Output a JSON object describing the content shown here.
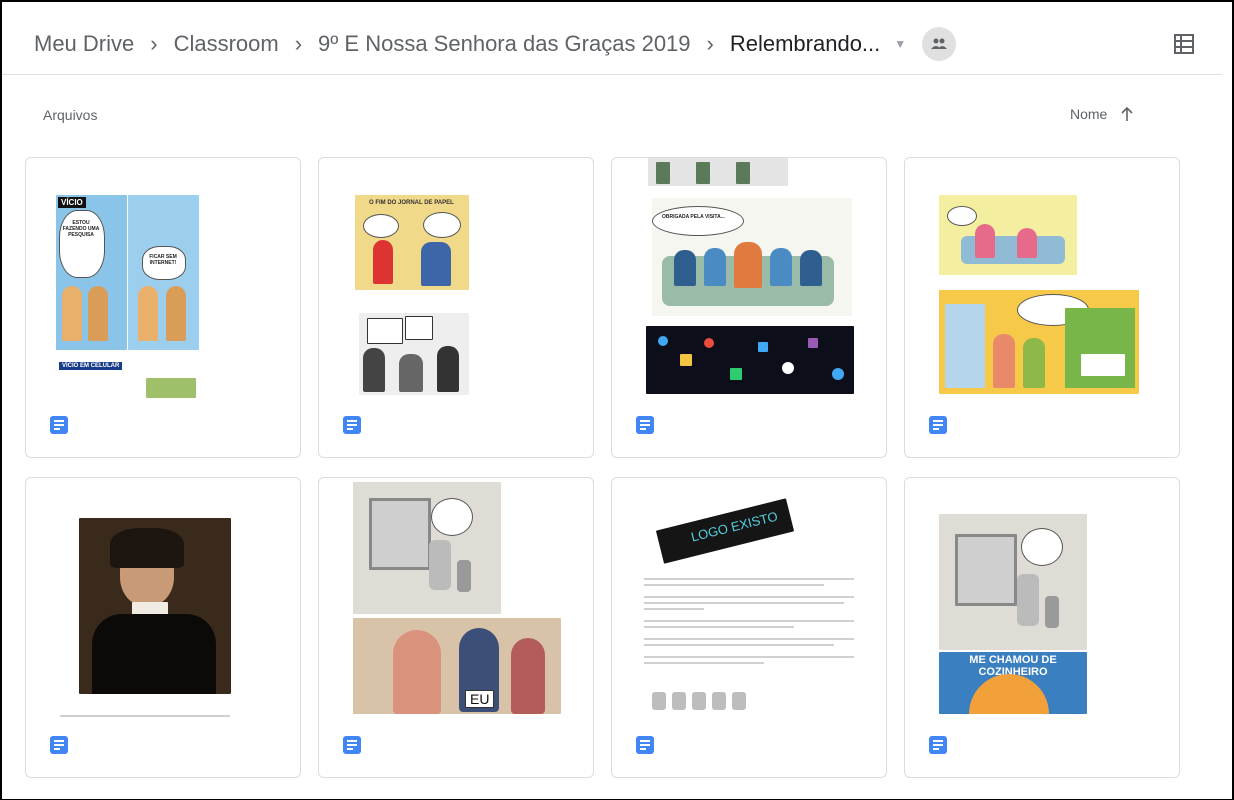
{
  "breadcrumb": {
    "items": [
      "Meu Drive",
      "Classroom",
      "9º E Nossa Senhora das Graças 2019",
      "Relembrando..."
    ],
    "separator": "›"
  },
  "section": {
    "label": "Arquivos"
  },
  "sort": {
    "label": "Nome",
    "direction": "ascending"
  },
  "files": [
    {
      "type": "google-doc",
      "thumbnail_text": [
        "VÍCIO",
        "ESTOU FAZENDO UMA PESQUISA",
        "FICAR SEM INTERNET!",
        "VÍCIO EM CELULAR"
      ]
    },
    {
      "type": "google-doc",
      "thumbnail_text": [
        "O FIM DO JORNAL DE PAPEL"
      ]
    },
    {
      "type": "google-doc",
      "thumbnail_text": [
        "OBRIGADA PELA VISITA..."
      ]
    },
    {
      "type": "google-doc",
      "thumbnail_text": []
    },
    {
      "type": "google-doc",
      "thumbnail_text": []
    },
    {
      "type": "google-doc",
      "thumbnail_text": [
        "EU"
      ]
    },
    {
      "type": "google-doc",
      "thumbnail_text": [
        "LOGO EXISTO"
      ]
    },
    {
      "type": "google-doc",
      "thumbnail_text": [
        "ME CHAMOU DE COZINHEIRO"
      ]
    }
  ],
  "colors": {
    "doc_icon": "#4285f4",
    "border": "#dadce0",
    "text": "#5f6368"
  }
}
